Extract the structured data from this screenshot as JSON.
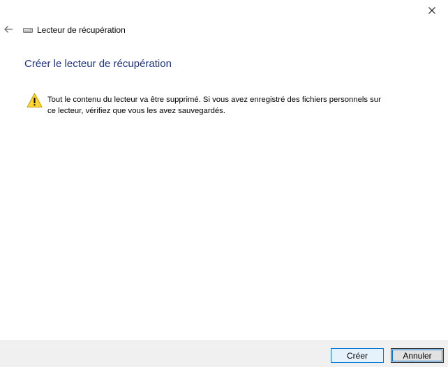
{
  "window": {
    "title": "Lecteur de récupération"
  },
  "main": {
    "heading": "Créer le lecteur de récupération",
    "warning_text": "Tout le contenu du lecteur va être supprimé. Si vous avez enregistré des fichiers personnels sur ce lecteur, vérifiez que vous les avez sauvegardés."
  },
  "footer": {
    "create_label": "Créer",
    "cancel_label": "Annuler"
  },
  "icons": {
    "back": "back-arrow-icon",
    "close": "close-icon",
    "drive": "drive-icon",
    "warning": "warning-icon"
  },
  "colors": {
    "heading": "#1e3287",
    "warning_fill": "#ffd62a",
    "footer_bg": "#f0f0f0",
    "focus_blue": "#0078d7"
  }
}
